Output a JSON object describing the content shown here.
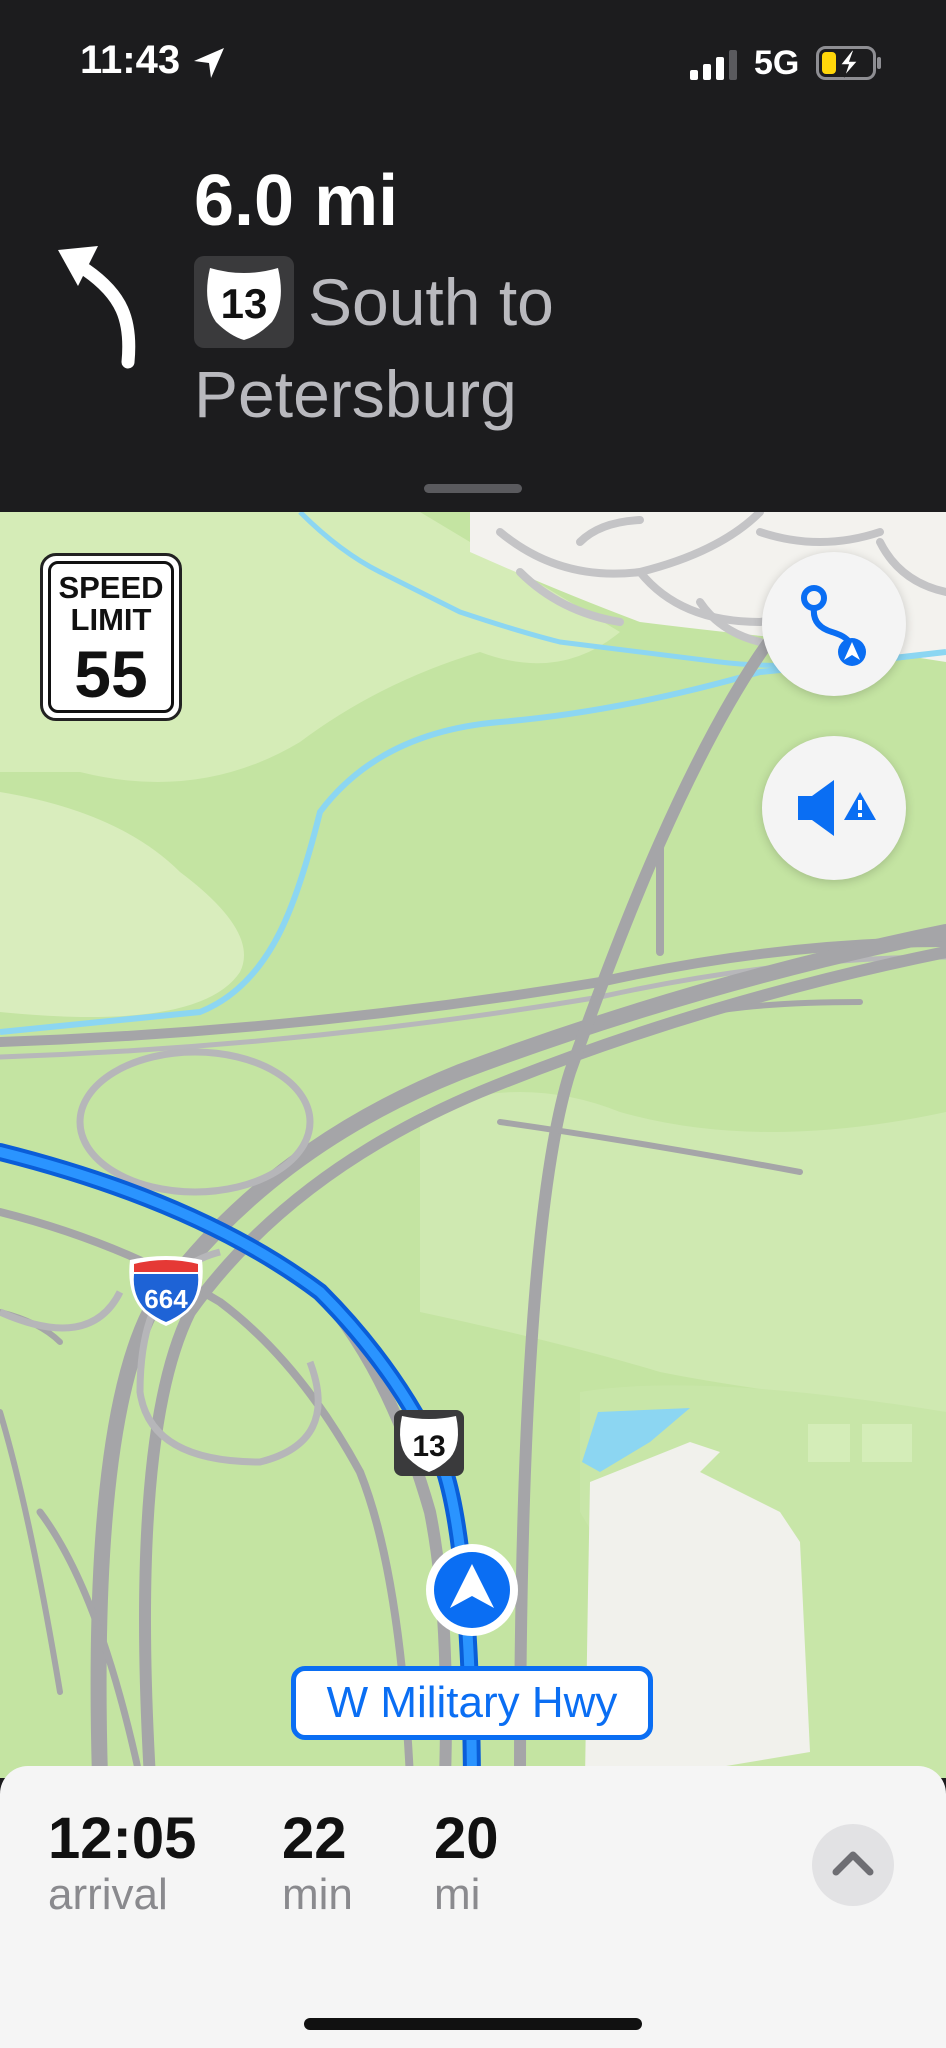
{
  "status_bar": {
    "time": "11:43",
    "network": "5G",
    "location_icon": "location-arrow-icon",
    "signal_icon": "signal-bars-icon",
    "battery_icon": "battery-charging-icon"
  },
  "navigation": {
    "distance": "6.0 mi",
    "route_shield": "13",
    "instruction_line1": "South to",
    "instruction_line2": "Petersburg",
    "turn_icon": "turn-left-arrow-icon"
  },
  "map": {
    "speed_limit": {
      "line1": "SPEED",
      "line2": "LIMIT",
      "value": "55"
    },
    "shield_interstate": "664",
    "shield_us_route": "13",
    "street_label": "W Military Hwy",
    "route_overview_icon": "route-overview-icon",
    "audio_icon": "speaker-alert-icon",
    "colors": {
      "route": "#1a84ff",
      "land": "#c4e4a2",
      "road": "#a0a0a4",
      "water": "#8cd6f2",
      "accent": "#0a6ef3"
    }
  },
  "trip_summary": {
    "arrival": {
      "value": "12:05",
      "unit": "arrival"
    },
    "duration": {
      "value": "22",
      "unit": "min"
    },
    "distance": {
      "value": "20",
      "unit": "mi"
    },
    "expand_icon": "chevron-up-icon"
  }
}
